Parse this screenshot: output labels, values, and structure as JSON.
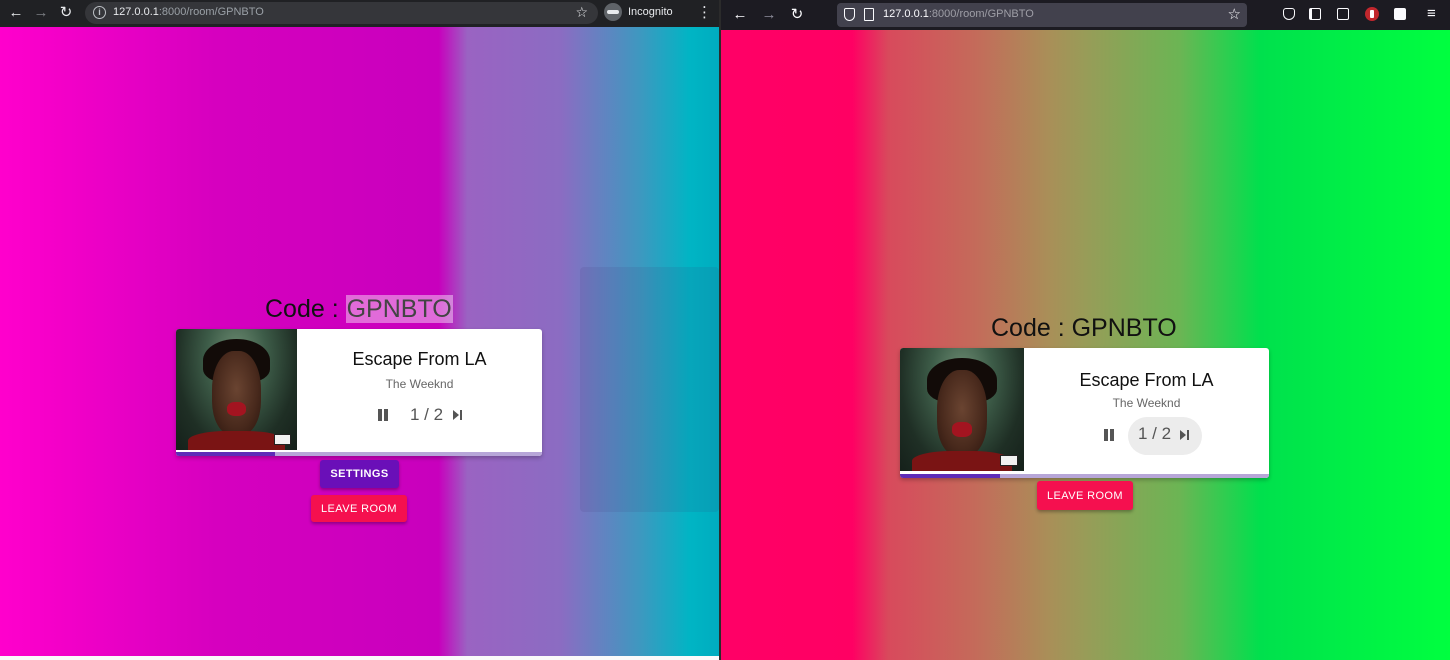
{
  "chrome": {
    "url_host": "127.0.0.1",
    "url_rest": ":8000/room/GPNBTO",
    "incognito_label": "Incognito",
    "icons": {
      "back": "arrow-left-icon",
      "forward": "arrow-right-icon",
      "reload": "reload-icon",
      "info": "info-icon",
      "bookmark": "star-icon",
      "menu": "kebab-menu-icon"
    }
  },
  "firefox": {
    "url_host": "127.0.0.1",
    "url_rest": ":8000/room/GPNBTO",
    "icons": {
      "back": "arrow-left-icon",
      "forward": "arrow-right-icon",
      "reload": "reload-icon",
      "bookmark": "star-icon",
      "menu": "hamburger-menu-icon"
    }
  },
  "room": {
    "code_label": "Code : ",
    "code": "GPNBTO"
  },
  "player": {
    "title": "Escape From LA",
    "artist": "The Weeknd",
    "votes_current": "1",
    "votes_required": "2",
    "votes_text": "1 / 2",
    "progress_fraction_left": 0.27,
    "progress_fraction_right": 0.27
  },
  "buttons": {
    "settings": "SETTINGS",
    "leave_left": "LEAVE ROOM",
    "leave_right": "LEAVE ROOM"
  },
  "colors": {
    "left_gradient": [
      "#ff00cc",
      "#c800bd",
      "#8b6cc2",
      "#00b5c4"
    ],
    "right_gradient": [
      "#ff0066",
      "#c46b5a",
      "#989c58",
      "#00ff3f"
    ],
    "settings_button": "#6a0fb8",
    "leave_button": "#f5104f",
    "progress_fill": "#5e2bb8"
  }
}
